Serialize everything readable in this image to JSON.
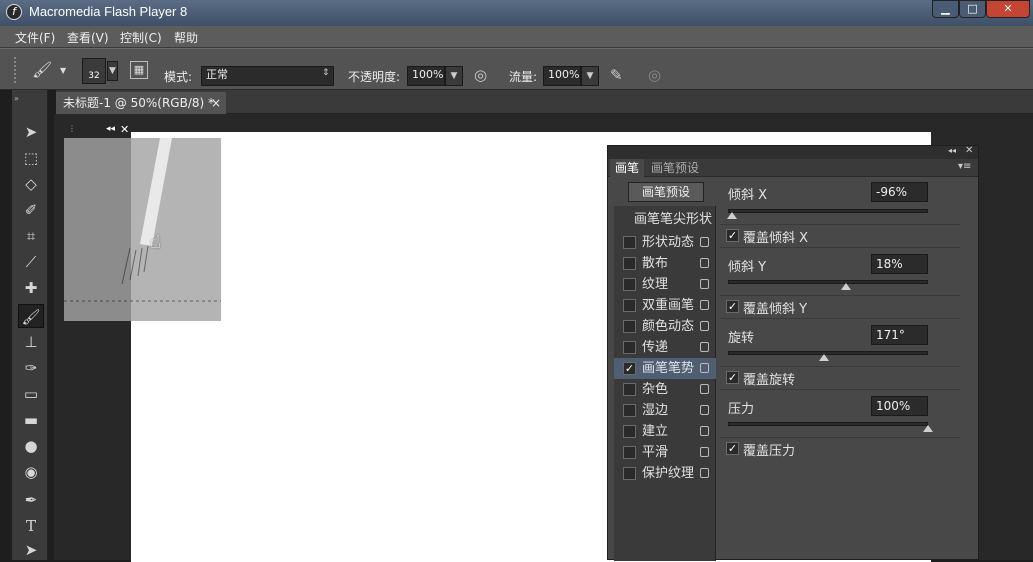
{
  "window": {
    "title": "Macromedia Flash Player 8",
    "min": "▁",
    "max": "□",
    "close": "✕"
  },
  "menu": {
    "file": "文件(F)",
    "view": "查看(V)",
    "control": "控制(C)",
    "help": "帮助"
  },
  "options": {
    "brush_size": "32",
    "mode_label": "模式:",
    "mode_value": "正常",
    "opacity_label": "不透明度:",
    "opacity_value": "100%",
    "flow_label": "流量:",
    "flow_value": "100%"
  },
  "doc_tab": {
    "title": "未标题-1 @ 50%(RGB/8) *",
    "close": "×"
  },
  "panel": {
    "tabs": [
      "画笔",
      "画笔预设"
    ],
    "preset_button": "画笔预设",
    "tip_shape": "画笔笔尖形状",
    "items": [
      {
        "label": "形状动态",
        "checked": false
      },
      {
        "label": "散布",
        "checked": false
      },
      {
        "label": "纹理",
        "checked": false
      },
      {
        "label": "双重画笔",
        "checked": false
      },
      {
        "label": "颜色动态",
        "checked": false
      },
      {
        "label": "传递",
        "checked": false
      },
      {
        "label": "画笔笔势",
        "checked": true
      },
      {
        "label": "杂色",
        "checked": false
      },
      {
        "label": "湿边",
        "checked": false
      },
      {
        "label": "建立",
        "checked": false
      },
      {
        "label": "平滑",
        "checked": false
      },
      {
        "label": "保护纹理",
        "checked": false
      }
    ],
    "tilt_x": {
      "label": "倾斜 X",
      "value": "-96%",
      "level": 0.02
    },
    "override_tilt_x": {
      "label": "覆盖倾斜 X",
      "checked": true
    },
    "tilt_y": {
      "label": "倾斜 Y",
      "value": "18%",
      "level": 0.59
    },
    "override_tilt_y": {
      "label": "覆盖倾斜 Y",
      "checked": true
    },
    "rotation": {
      "label": "旋转",
      "value": "171°",
      "level": 0.48
    },
    "override_rotation": {
      "label": "覆盖旋转",
      "checked": true
    },
    "pressure": {
      "label": "压力",
      "value": "100%",
      "level": 1.0
    },
    "override_pressure": {
      "label": "覆盖压力",
      "checked": true
    }
  }
}
